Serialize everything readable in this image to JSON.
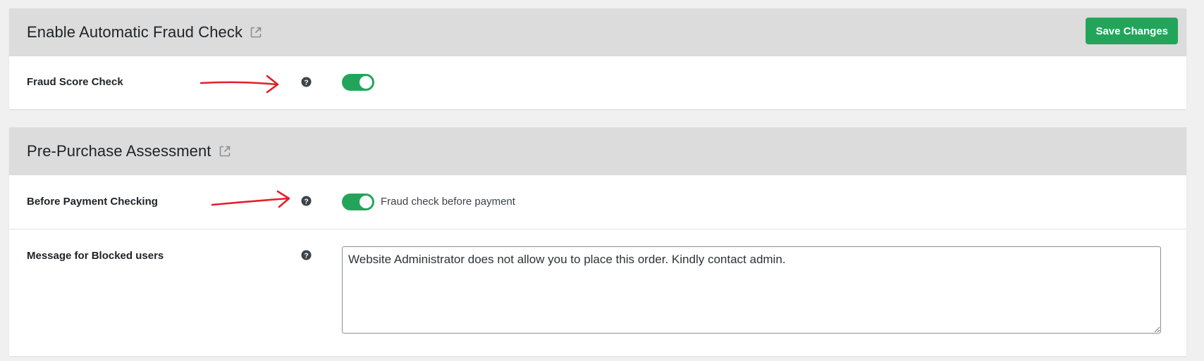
{
  "sections": [
    {
      "title": "Enable Automatic Fraud Check",
      "save_label": "Save Changes",
      "rows": [
        {
          "label": "Fraud Score Check",
          "toggle_on": true
        }
      ]
    },
    {
      "title": "Pre-Purchase Assessment",
      "rows": [
        {
          "label": "Before Payment Checking",
          "toggle_on": true,
          "toggle_text": "Fraud check before payment"
        },
        {
          "label": "Message for Blocked users",
          "textarea_value": "Website Administrator does not allow you to place this order. Kindly contact admin."
        }
      ]
    }
  ],
  "colors": {
    "accent_green": "#22a55a",
    "header_bg": "#dcdcdc",
    "annotation_arrow": "#e0202b"
  },
  "icons": {
    "external_link": "external-link-icon",
    "help": "question-circle-icon",
    "annotation": "red-arrow-annotation"
  }
}
